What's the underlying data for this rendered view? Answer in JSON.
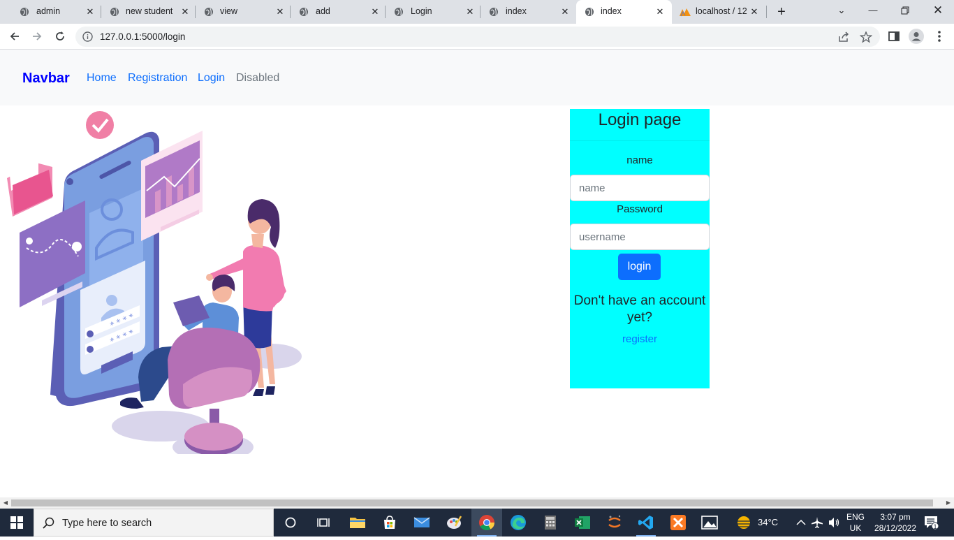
{
  "browser": {
    "tabs": [
      {
        "title": "admin",
        "active": false
      },
      {
        "title": "new student",
        "active": false
      },
      {
        "title": "view",
        "active": false
      },
      {
        "title": "add",
        "active": false
      },
      {
        "title": "Login",
        "active": false
      },
      {
        "title": "index",
        "active": false
      },
      {
        "title": "index",
        "active": true
      },
      {
        "title": "localhost / 12",
        "active": false
      }
    ],
    "url": "127.0.0.1:5000/login"
  },
  "navbar": {
    "brand": "Navbar",
    "links": [
      "Home",
      "Registration",
      "Login",
      "Disabled"
    ]
  },
  "login": {
    "title": "Login page",
    "name_label": "name",
    "name_placeholder": "name",
    "password_label": "Password",
    "password_placeholder": "username",
    "submit_label": "login",
    "signup_prompt": "Don't have an account yet?",
    "register_link": "register"
  },
  "taskbar": {
    "search_placeholder": "Type here to search",
    "weather": "34°C",
    "language": "ENG",
    "region": "UK",
    "time": "3:07 pm",
    "date": "28/12/2022",
    "notification_count": "1"
  },
  "colors": {
    "card_bg": "#00ffff",
    "brand": "#0000ff",
    "primary": "#0d6efd",
    "navbar_bg": "#f8f9fa"
  }
}
